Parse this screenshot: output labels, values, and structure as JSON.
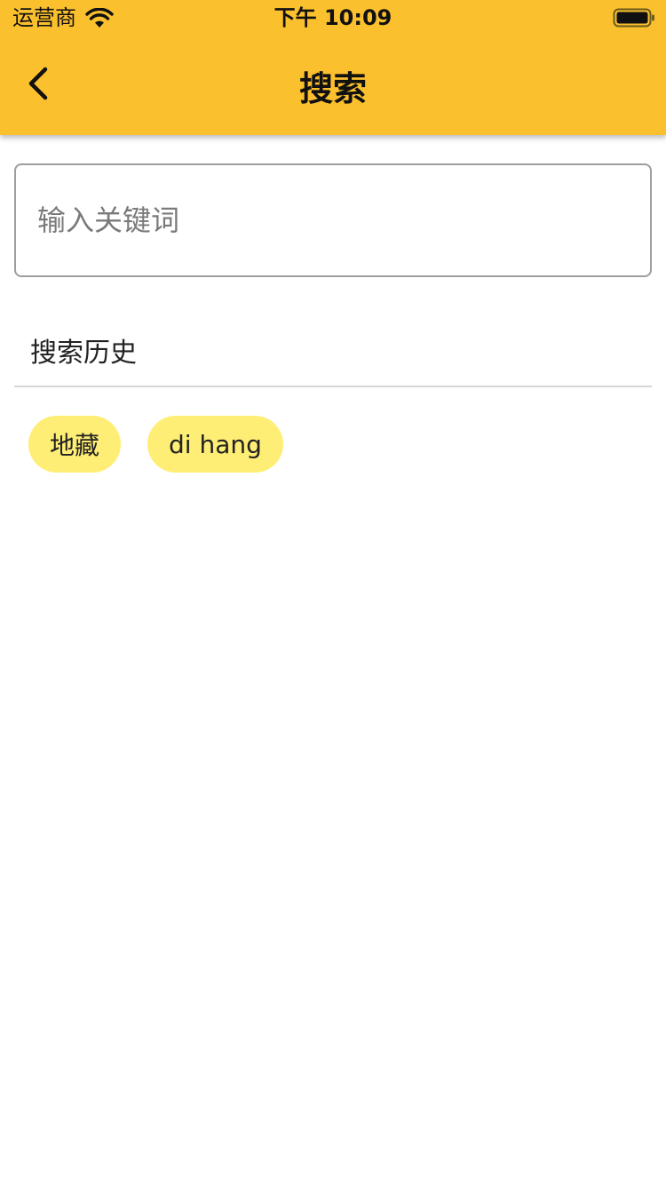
{
  "status_bar": {
    "carrier": "运营商",
    "time": "下午 10:09"
  },
  "header": {
    "title": "搜索",
    "back_icon": "chevron-left-icon",
    "background_color": "#FBC02D"
  },
  "search": {
    "placeholder": "输入关键词",
    "value": ""
  },
  "history": {
    "title": "搜索历史",
    "chip_color": "#FFEE75",
    "items": [
      "地藏",
      "di hang"
    ]
  }
}
